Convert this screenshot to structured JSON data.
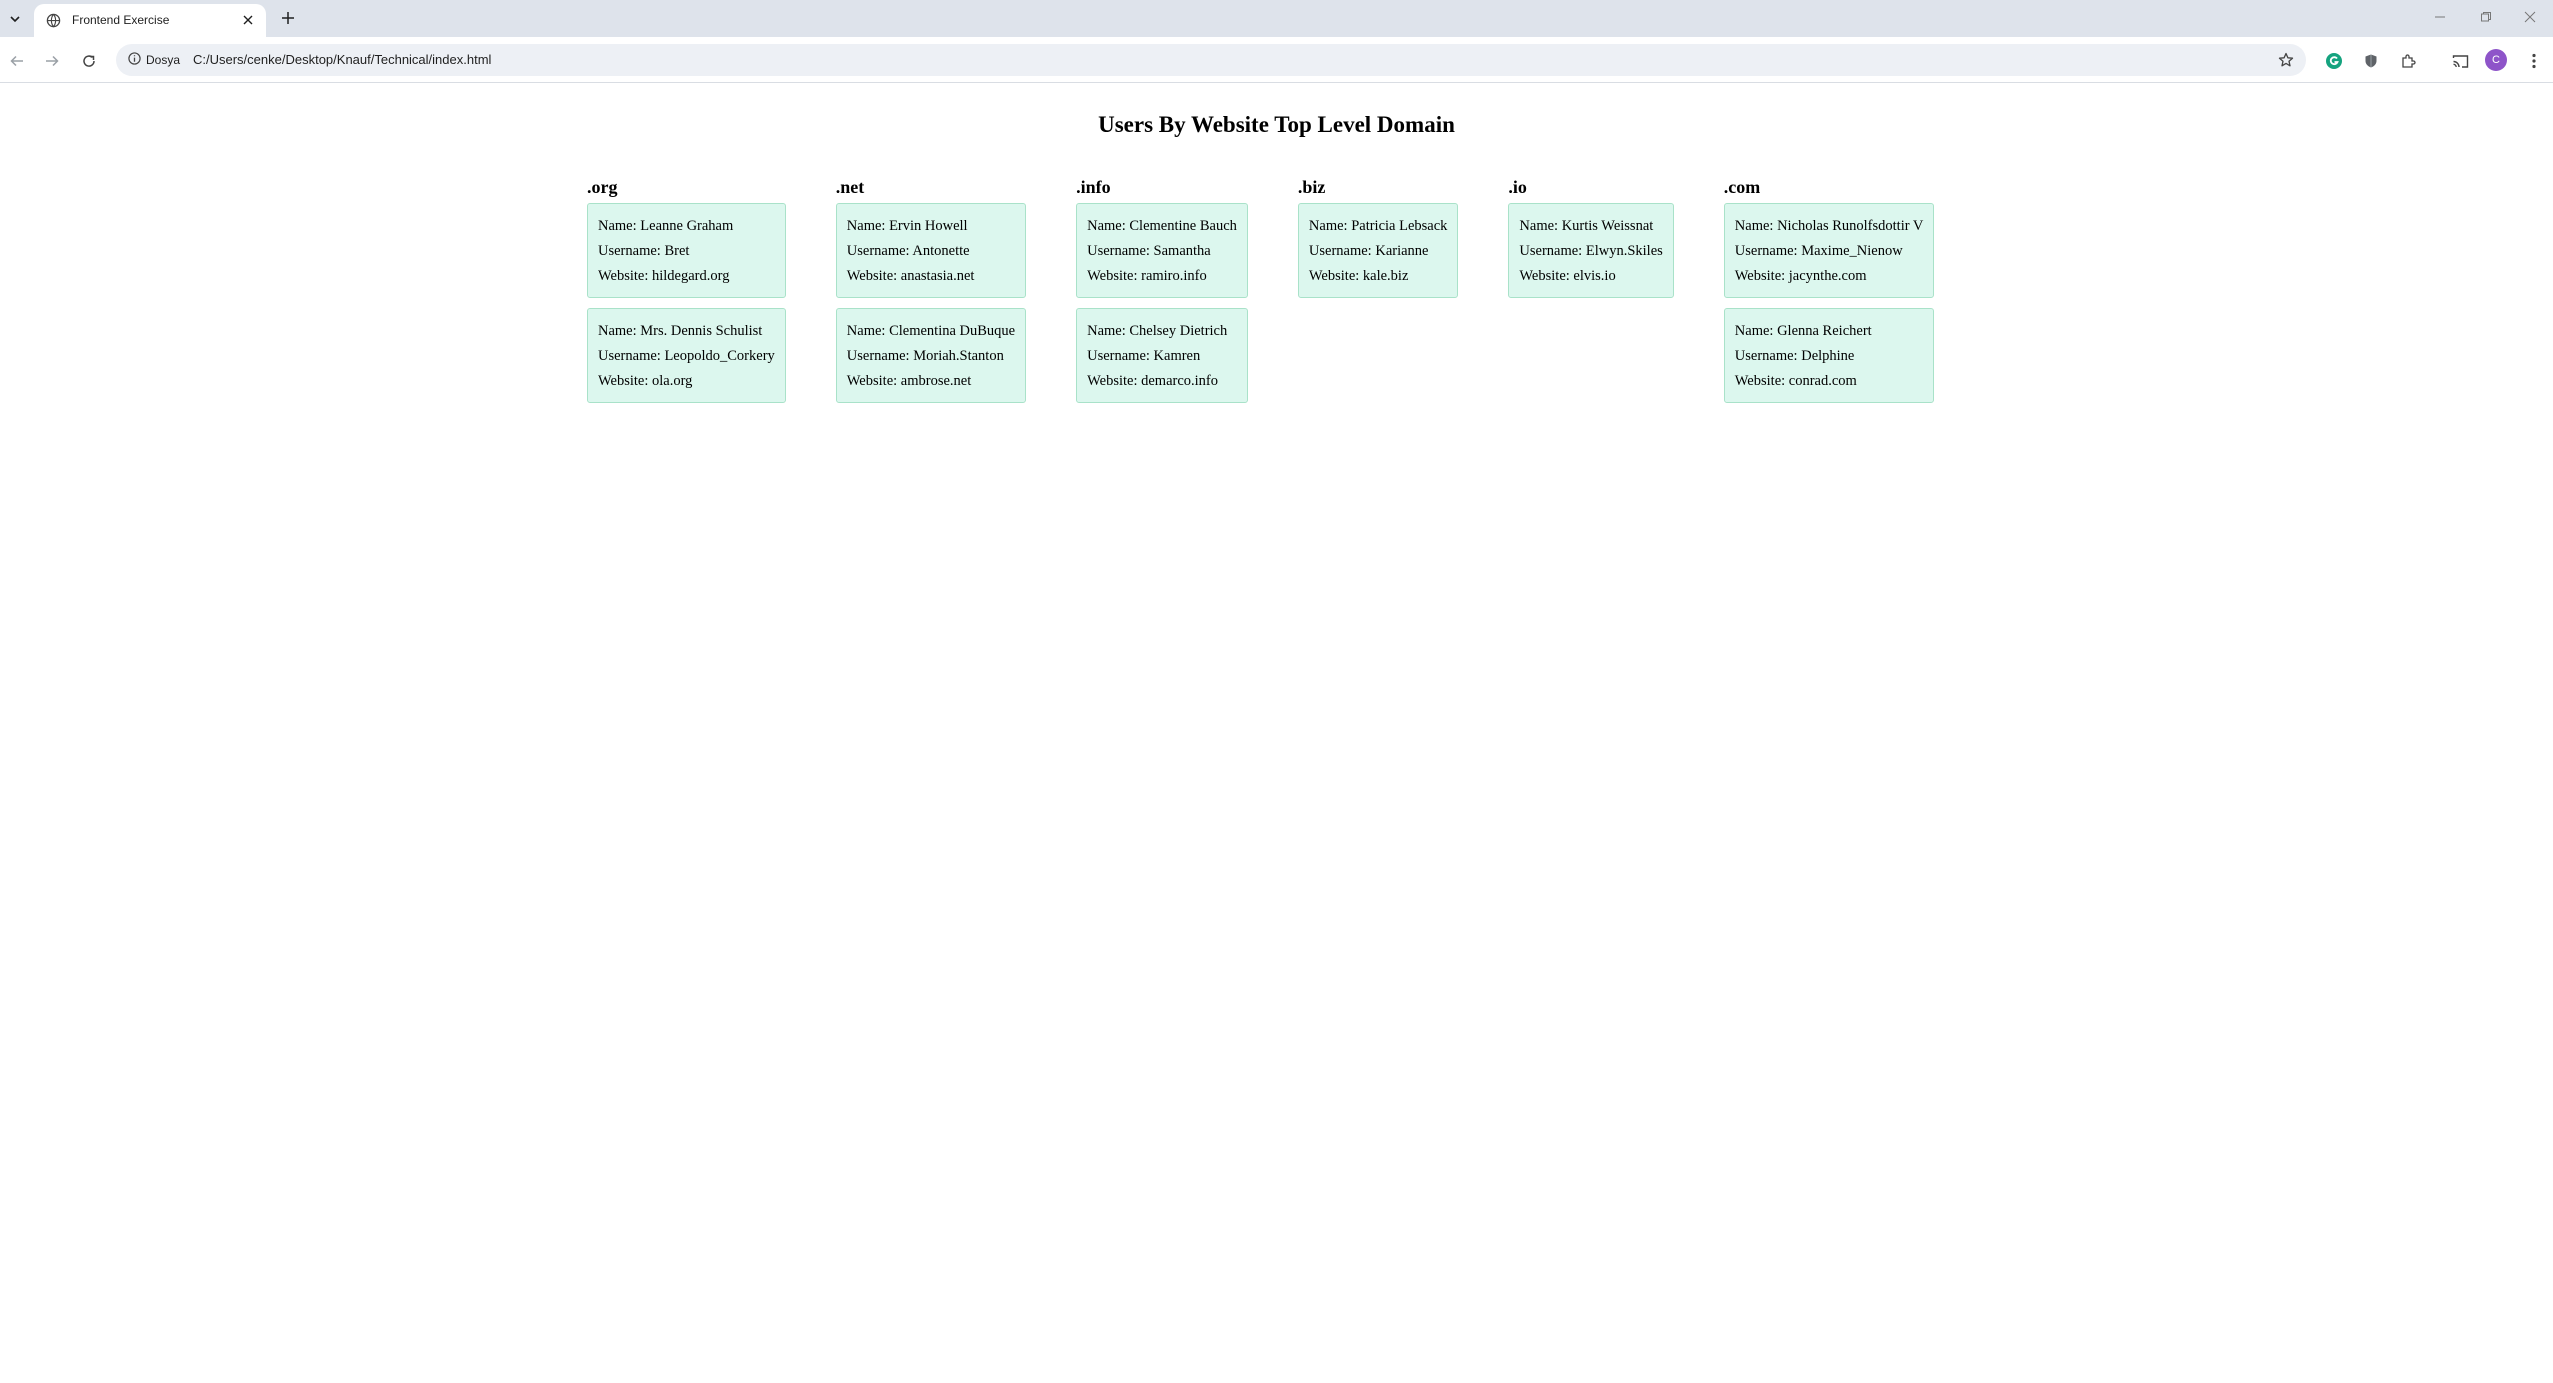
{
  "browser": {
    "tab_title": "Frontend Exercise",
    "site_chip_label": "Dosya",
    "url": "C:/Users/cenke/Desktop/Knauf/Technical/index.html",
    "avatar_letter": "C"
  },
  "page": {
    "title": "Users By Website Top Level Domain",
    "labels": {
      "name": "Name:",
      "username": "Username:",
      "website": "Website:"
    },
    "columns": [
      {
        "tld": ".org",
        "users": [
          {
            "name": "Leanne Graham",
            "username": "Bret",
            "website": "hildegard.org"
          },
          {
            "name": "Mrs. Dennis Schulist",
            "username": "Leopoldo_Corkery",
            "website": "ola.org"
          }
        ]
      },
      {
        "tld": ".net",
        "users": [
          {
            "name": "Ervin Howell",
            "username": "Antonette",
            "website": "anastasia.net"
          },
          {
            "name": "Clementina DuBuque",
            "username": "Moriah.Stanton",
            "website": "ambrose.net"
          }
        ]
      },
      {
        "tld": ".info",
        "users": [
          {
            "name": "Clementine Bauch",
            "username": "Samantha",
            "website": "ramiro.info"
          },
          {
            "name": "Chelsey Dietrich",
            "username": "Kamren",
            "website": "demarco.info"
          }
        ]
      },
      {
        "tld": ".biz",
        "users": [
          {
            "name": "Patricia Lebsack",
            "username": "Karianne",
            "website": "kale.biz"
          }
        ]
      },
      {
        "tld": ".io",
        "users": [
          {
            "name": "Kurtis Weissnat",
            "username": "Elwyn.Skiles",
            "website": "elvis.io"
          }
        ]
      },
      {
        "tld": ".com",
        "users": [
          {
            "name": "Nicholas Runolfsdottir V",
            "username": "Maxime_Nienow",
            "website": "jacynthe.com"
          },
          {
            "name": "Glenna Reichert",
            "username": "Delphine",
            "website": "conrad.com"
          }
        ]
      }
    ]
  }
}
